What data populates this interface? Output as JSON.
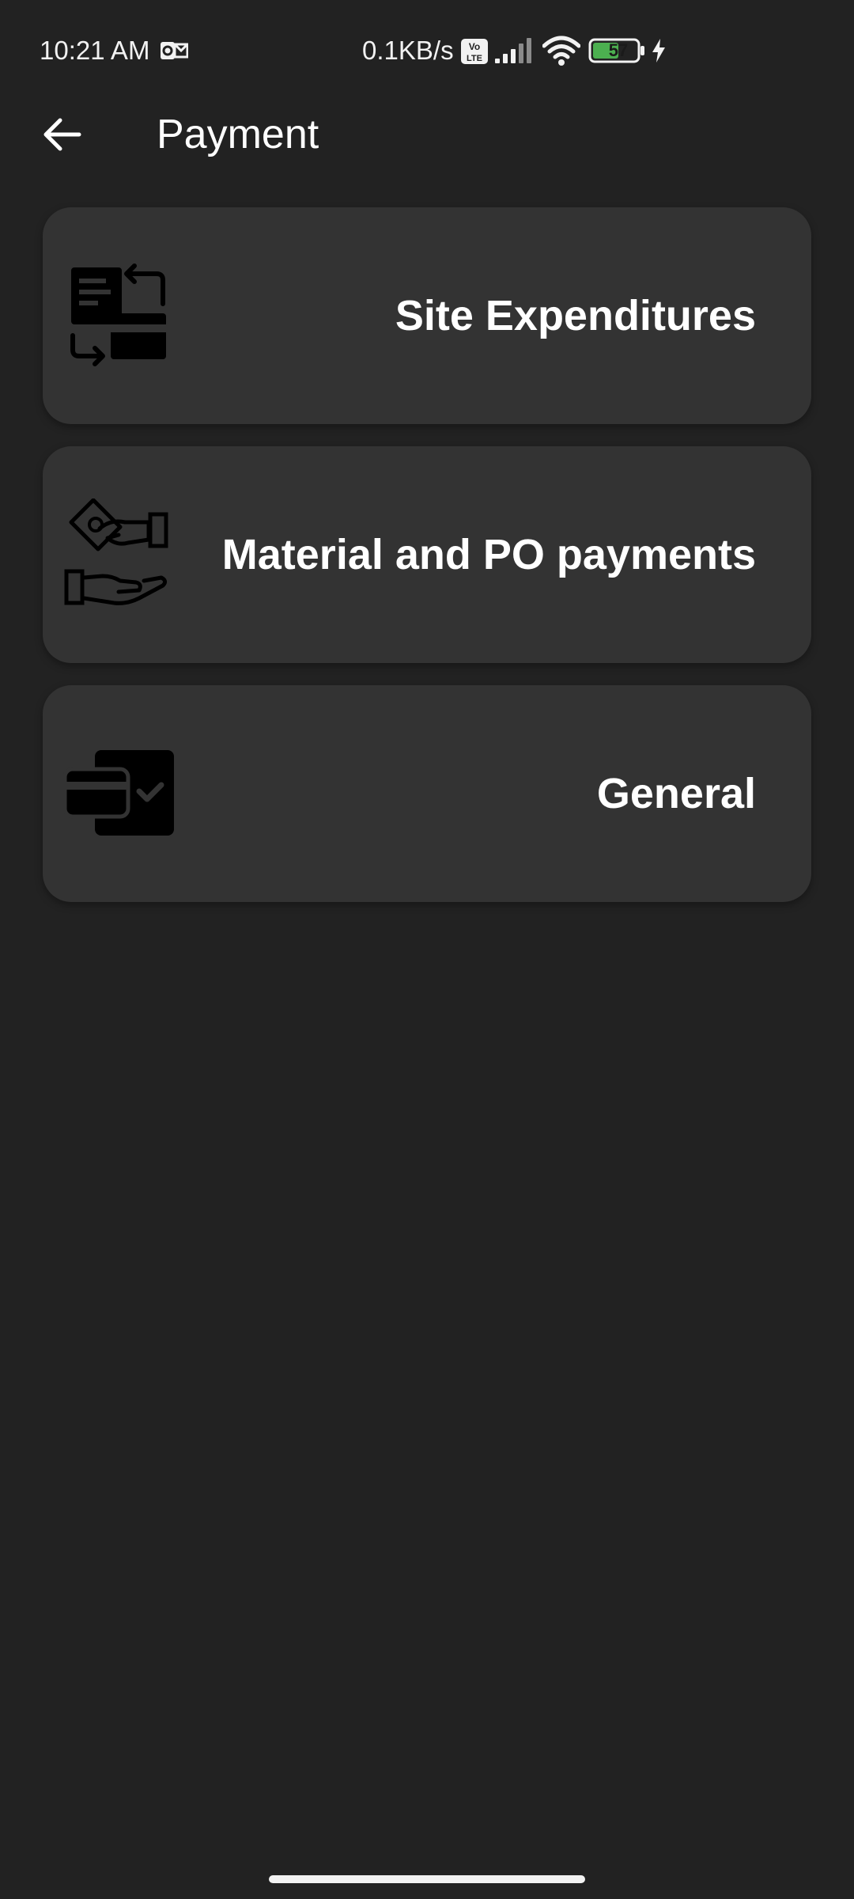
{
  "status_bar": {
    "time": "10:21 AM",
    "net_speed": "0.1KB/s",
    "battery_level": "57",
    "icons": [
      "outlook-icon",
      "volte-icon",
      "signal-icon",
      "wifi-icon",
      "battery-icon",
      "charging-icon"
    ],
    "battery_color": "#4caf50"
  },
  "header": {
    "title": "Payment",
    "back_icon": "arrow-left-icon"
  },
  "cards": [
    {
      "label": "Site Expenditures",
      "icon": "transfer-icon"
    },
    {
      "label": "Material and PO payments",
      "icon": "hand-money-icon"
    },
    {
      "label": "General",
      "icon": "card-check-icon"
    }
  ],
  "colors": {
    "background": "#222222",
    "card": "#333333",
    "text": "#ffffff",
    "icon": "#000000"
  }
}
